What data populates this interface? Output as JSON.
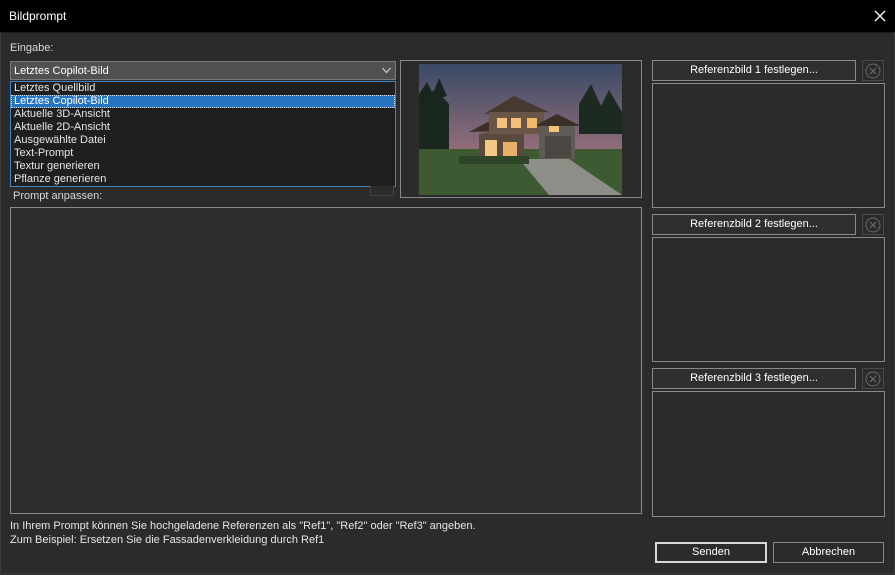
{
  "window": {
    "title": "Bildprompt"
  },
  "input": {
    "label": "Eingabe:",
    "selected": "Letztes Copilot-Bild",
    "options": [
      "Letztes Quellbild",
      "Letztes Copilot-Bild",
      "Aktuelle 3D-Ansicht",
      "Aktuelle 2D-Ansicht",
      "Ausgewählte Datei",
      "Text-Prompt",
      "Textur generieren",
      "Pflanze generieren"
    ]
  },
  "prompt": {
    "label": "Prompt anpassen:",
    "value": ""
  },
  "references": [
    {
      "button_label": "Referenzbild 1 festlegen..."
    },
    {
      "button_label": "Referenzbild 2 festlegen..."
    },
    {
      "button_label": "Referenzbild 3 festlegen..."
    }
  ],
  "hint": {
    "line1": "In Ihrem Prompt können Sie hochgeladene Referenzen als \"Ref1\", \"Ref2\" oder \"Ref3\" angeben.",
    "line2": "Zum Beispiel: Ersetzen Sie die Fassadenverkleidung durch Ref1"
  },
  "actions": {
    "send_label": "Senden",
    "cancel_label": "Abbrechen"
  },
  "colors": {
    "accent": "#2874c0",
    "background": "#2b2b2b",
    "titlebar": "#000000"
  },
  "icons": {
    "close": "close-icon",
    "dropdown": "chevron-down-icon",
    "clear": "clear-circle-icon"
  }
}
